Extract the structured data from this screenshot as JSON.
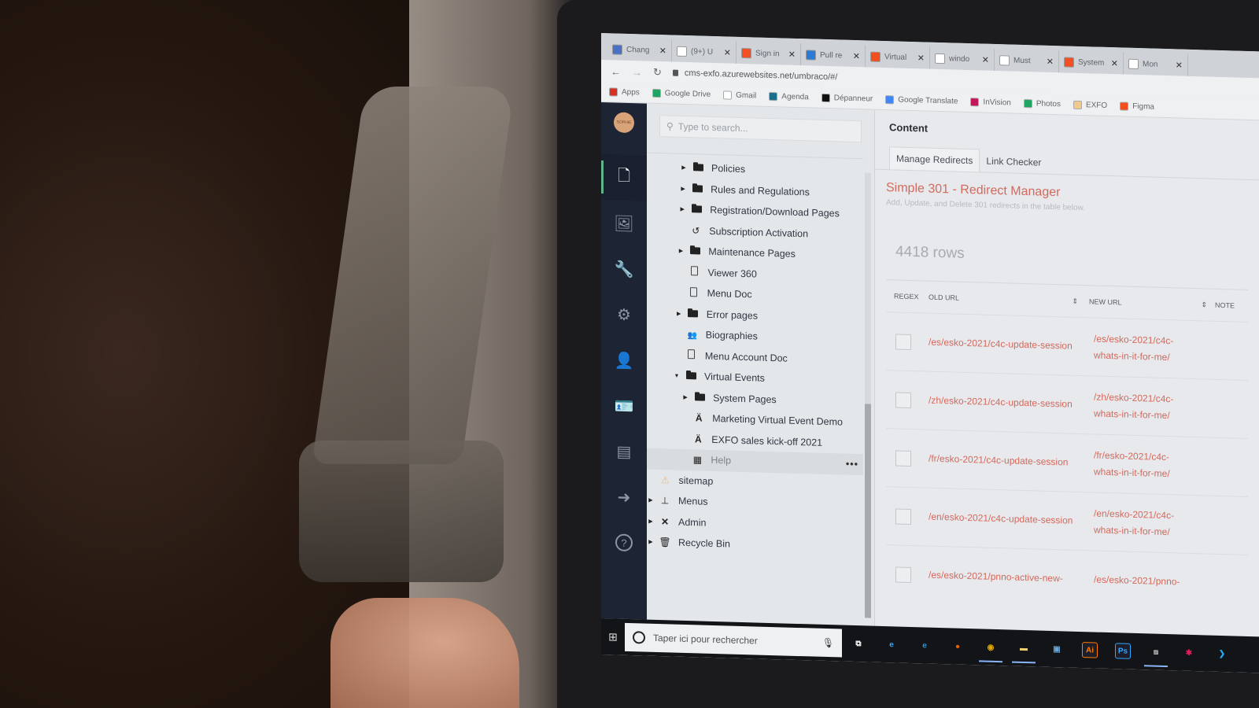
{
  "browser": {
    "tabs": [
      {
        "label": "Chang",
        "icon": "app-icon",
        "color": "#4a72c4"
      },
      {
        "label": "(9+) U",
        "icon": "notion-icon",
        "color": "#ffffff"
      },
      {
        "label": "Sign in",
        "icon": "microsoft-icon",
        "color": "#f25022"
      },
      {
        "label": "Pull re",
        "icon": "azure-devops-icon",
        "color": "#2b7bd6"
      },
      {
        "label": "Virtual",
        "icon": "figma-icon",
        "color": "#f24e1e"
      },
      {
        "label": "windo",
        "icon": "google-icon",
        "color": "#ffffff"
      },
      {
        "label": "Must",
        "icon": "google-icon",
        "color": "#ffffff"
      },
      {
        "label": "System",
        "icon": "microsoft-icon",
        "color": "#f25022"
      },
      {
        "label": "Mon",
        "icon": "moon-icon",
        "color": "#ffffff"
      }
    ],
    "url": "cms-exfo.azurewebsites.net/umbraco/#/",
    "bookmarks": [
      {
        "label": "Apps",
        "icon": "apps-grid-icon",
        "color": "#d93025"
      },
      {
        "label": "Google Drive",
        "icon": "google-drive-icon",
        "color": "#1fa463"
      },
      {
        "label": "Gmail",
        "icon": "google-icon",
        "color": "#ffffff"
      },
      {
        "label": "Agenda",
        "icon": "calendar-icon",
        "color": "#1a6e8a"
      },
      {
        "label": "Dépanneur",
        "icon": "dollar-circle-icon",
        "color": "#111111"
      },
      {
        "label": "Google Translate",
        "icon": "translate-icon",
        "color": "#4285f4"
      },
      {
        "label": "InVision",
        "icon": "invision-icon",
        "color": "#c2185b"
      },
      {
        "label": "Photos",
        "icon": "google-drive-icon",
        "color": "#1fa463"
      },
      {
        "label": "EXFO",
        "icon": "bookmark-folder-icon",
        "color": "#f2c98a"
      },
      {
        "label": "Figma",
        "icon": "figma-icon",
        "color": "#f24e1e"
      }
    ]
  },
  "sidebar": {
    "avatar_text": "SOPHIE",
    "items": [
      {
        "name": "content",
        "icon": "document-icon",
        "active": true
      },
      {
        "name": "media",
        "icon": "image-icon",
        "active": false
      },
      {
        "name": "settings",
        "icon": "wrench-icon",
        "active": false
      },
      {
        "name": "developer",
        "icon": "gear-icon",
        "active": false
      },
      {
        "name": "users",
        "icon": "user-icon",
        "active": false
      },
      {
        "name": "members",
        "icon": "id-card-icon",
        "active": false
      },
      {
        "name": "forms",
        "icon": "forms-icon",
        "active": false
      },
      {
        "name": "redirects",
        "icon": "arrow-right-icon",
        "active": false
      },
      {
        "name": "help",
        "icon": "help-icon",
        "active": false
      }
    ]
  },
  "tree": {
    "search_placeholder": "Type to search...",
    "nodes": [
      {
        "label": "Policies",
        "icon": "folder",
        "caret": "right",
        "level": 2
      },
      {
        "label": "Rules and Regulations",
        "icon": "folder",
        "caret": "right",
        "level": 2
      },
      {
        "label": "Registration/Download Pages",
        "icon": "folder",
        "caret": "right",
        "level": 2
      },
      {
        "label": "Subscription Activation",
        "icon": "history",
        "caret": "",
        "level": 2
      },
      {
        "label": "Maintenance Pages",
        "icon": "folder",
        "caret": "right",
        "level": 2
      },
      {
        "label": "Viewer 360",
        "icon": "doc",
        "caret": "",
        "level": 2
      },
      {
        "label": "Menu Doc",
        "icon": "doc",
        "caret": "",
        "level": 2
      },
      {
        "label": "Error pages",
        "icon": "folder",
        "caret": "right",
        "level": 2
      },
      {
        "label": "Biographies",
        "icon": "people",
        "caret": "",
        "level": 2
      },
      {
        "label": "Menu Account Doc",
        "icon": "doc",
        "caret": "",
        "level": 2
      },
      {
        "label": "Virtual Events",
        "icon": "folder",
        "caret": "down",
        "level": 2
      },
      {
        "label": "System Pages",
        "icon": "folder",
        "caret": "right",
        "level": 3
      },
      {
        "label": "Marketing Virtual Event Demo",
        "icon": "broadcast",
        "caret": "",
        "level": 3
      },
      {
        "label": "EXFO sales kick-off 2021",
        "icon": "broadcast",
        "caret": "",
        "level": 3
      },
      {
        "label": "Help",
        "icon": "layout",
        "caret": "",
        "level": 3,
        "dim": true
      },
      {
        "label": "sitemap",
        "icon": "sitemap",
        "caret": "",
        "level": 1
      },
      {
        "label": "Menus",
        "icon": "hierarchy",
        "caret": "right",
        "level": 1
      },
      {
        "label": "Admin",
        "icon": "tools",
        "caret": "right",
        "level": 1
      },
      {
        "label": "Recycle Bin",
        "icon": "trash",
        "caret": "right",
        "level": 1
      }
    ],
    "more_actions": "•••"
  },
  "editor": {
    "header": "Content",
    "tabs": [
      {
        "label": "Manage Redirects",
        "active": true
      },
      {
        "label": "Link Checker",
        "active": false
      }
    ],
    "title": "Simple 301 - Redirect Manager",
    "subtitle": "Add, Update, and Delete 301 redirects in the table below.",
    "rows_count": "4418 rows",
    "table": {
      "headers": {
        "regex": "REGEX",
        "old_url": "OLD URL",
        "new_url": "NEW URL",
        "notes": "NOTE",
        "sort": "⇕"
      },
      "rows": [
        {
          "regex": false,
          "old_url": "/es/esko-2021/c4c-update-session",
          "new_url": "/es/esko-2021/c4c-whats-in-it-for-me/"
        },
        {
          "regex": false,
          "old_url": "/zh/esko-2021/c4c-update-session",
          "new_url": "/zh/esko-2021/c4c-whats-in-it-for-me/"
        },
        {
          "regex": false,
          "old_url": "/fr/esko-2021/c4c-update-session",
          "new_url": "/fr/esko-2021/c4c-whats-in-it-for-me/"
        },
        {
          "regex": false,
          "old_url": "/en/esko-2021/c4c-update-session",
          "new_url": "/en/esko-2021/c4c-whats-in-it-for-me/"
        },
        {
          "regex": false,
          "old_url": "/es/esko-2021/pnno-active-new-",
          "new_url": "/es/esko-2021/pnno-"
        }
      ]
    },
    "accent_color": "#d46a5e"
  },
  "taskbar": {
    "search_placeholder": "Taper ici pour rechercher",
    "apps": [
      {
        "name": "task-view",
        "icon": "task-view-icon",
        "glyph": "⧉",
        "color": "#ffffff",
        "open": false
      },
      {
        "name": "internet-explorer",
        "icon": "internet-explorer-icon",
        "glyph": "e",
        "color": "#3fa9f5",
        "open": false
      },
      {
        "name": "edge",
        "icon": "edge-icon",
        "glyph": "e",
        "color": "#2d9fd8",
        "open": false
      },
      {
        "name": "firefox",
        "icon": "firefox-icon",
        "glyph": "●",
        "color": "#e66000",
        "open": false
      },
      {
        "name": "chrome",
        "icon": "chrome-icon",
        "glyph": "◉",
        "color": "#e0a800",
        "open": true
      },
      {
        "name": "file-explorer",
        "icon": "folder-icon",
        "glyph": "▬",
        "color": "#f2d06b",
        "open": true
      },
      {
        "name": "remote-desktop",
        "icon": "remote-desktop-icon",
        "glyph": "▣",
        "color": "#6aa6d8",
        "open": false
      },
      {
        "name": "illustrator",
        "icon": "illustrator-icon",
        "glyph": "Ai",
        "color": "#ff7c00",
        "open": false
      },
      {
        "name": "photoshop",
        "icon": "photoshop-icon",
        "glyph": "Ps",
        "color": "#31a8ff",
        "open": false
      },
      {
        "name": "network",
        "icon": "network-icon",
        "glyph": "⧈",
        "color": "#bbbbbb",
        "open": true
      },
      {
        "name": "slack",
        "icon": "slack-icon",
        "glyph": "✱",
        "color": "#e01e5a",
        "open": false
      },
      {
        "name": "vscode",
        "icon": "vscode-icon",
        "glyph": "❯",
        "color": "#23a9f2",
        "open": false
      }
    ]
  }
}
